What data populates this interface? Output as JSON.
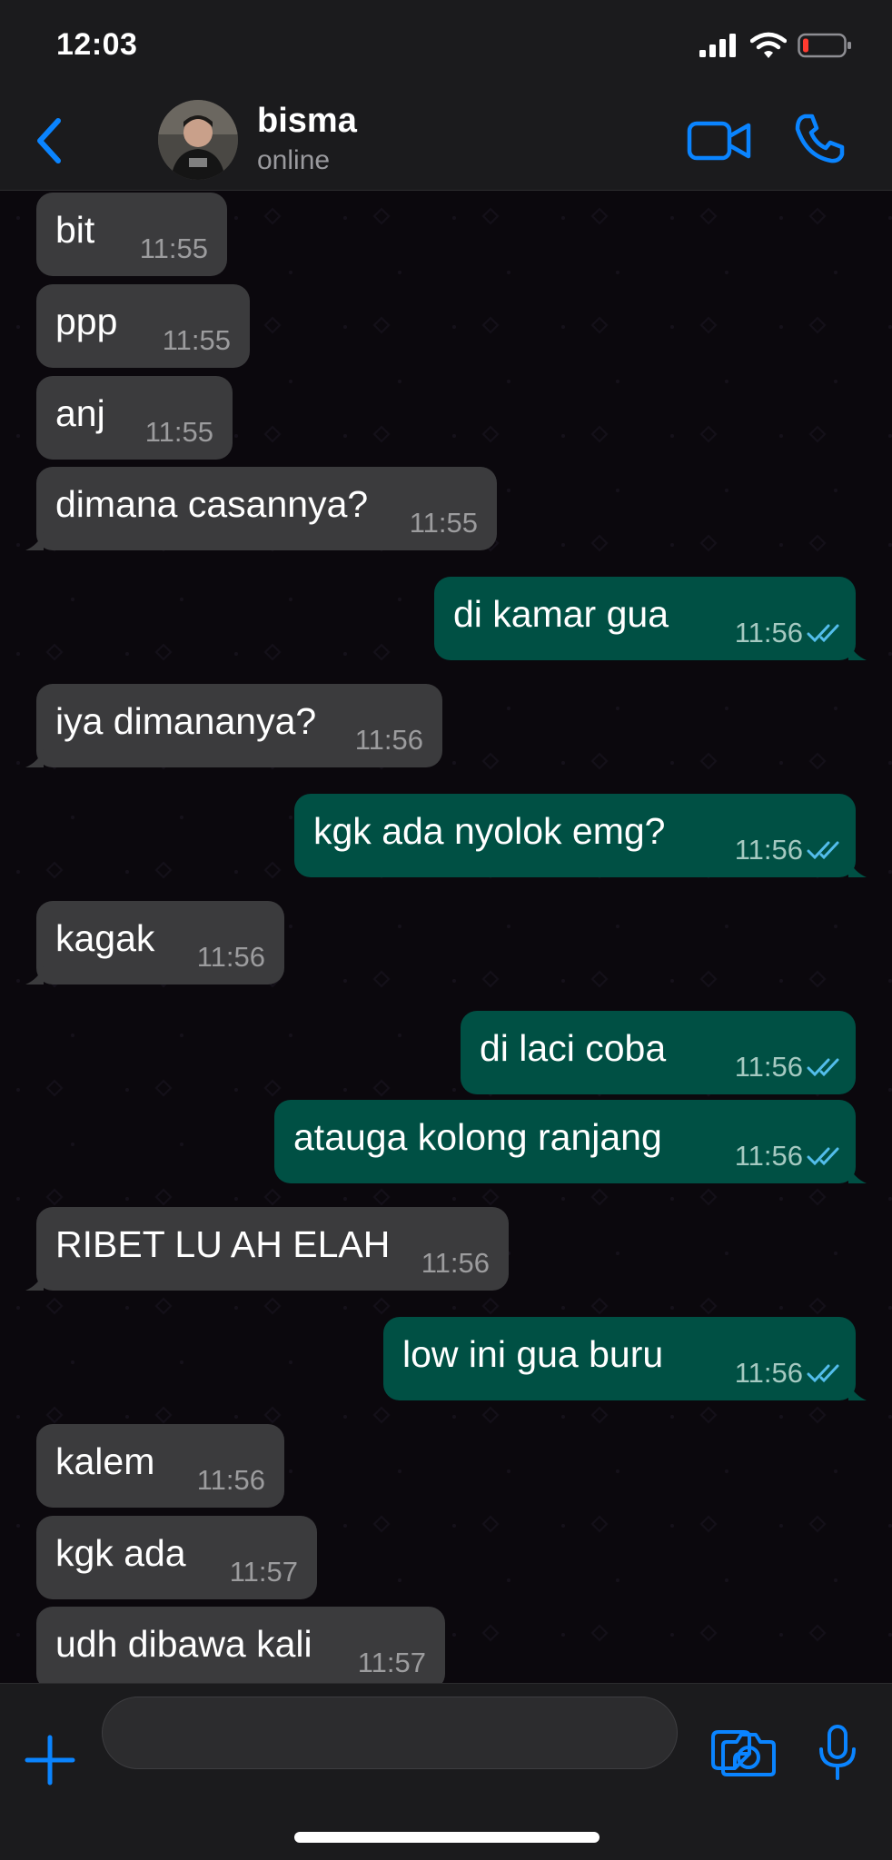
{
  "status_bar": {
    "time": "12:03"
  },
  "header": {
    "contact_name": "bisma",
    "contact_status": "online"
  },
  "messages": [
    {
      "dir": "in",
      "text": "bit",
      "time": "11:55"
    },
    {
      "dir": "in",
      "text": "ppp",
      "time": "11:55"
    },
    {
      "dir": "in",
      "text": "anj",
      "time": "11:55"
    },
    {
      "dir": "in",
      "text": "dimana casannya?",
      "time": "11:55"
    },
    {
      "dir": "out",
      "text": "di kamar gua",
      "time": "11:56"
    },
    {
      "dir": "in",
      "text": "iya dimananya?",
      "time": "11:56"
    },
    {
      "dir": "out",
      "text": "kgk ada nyolok emg?",
      "time": "11:56"
    },
    {
      "dir": "in",
      "text": "kagak",
      "time": "11:56"
    },
    {
      "dir": "out",
      "text": "di laci coba",
      "time": "11:56"
    },
    {
      "dir": "out",
      "text": "atauga kolong ranjang",
      "time": "11:56"
    },
    {
      "dir": "in",
      "text": "RIBET LU AH ELAH",
      "time": "11:56"
    },
    {
      "dir": "out",
      "text": "low ini gua buru",
      "time": "11:56"
    },
    {
      "dir": "in",
      "text": "kalem",
      "time": "11:56"
    },
    {
      "dir": "in",
      "text": "kgk ada",
      "time": "11:57"
    },
    {
      "dir": "in",
      "text": "udh dibawa kali",
      "time": "11:57"
    }
  ],
  "input": {
    "placeholder": ""
  },
  "colors": {
    "accent": "#0a84ff",
    "incoming_bubble": "#3b3b3d",
    "outgoing_bubble": "#005044",
    "read_ticks": "#53bdeb",
    "battery_low": "#ff3b30"
  },
  "icons": {
    "back": "chevron-left-icon",
    "video": "video-camera-icon",
    "call": "phone-icon",
    "plus": "plus-icon",
    "sticker": "sticker-icon",
    "camera": "camera-icon",
    "mic": "microphone-icon"
  }
}
